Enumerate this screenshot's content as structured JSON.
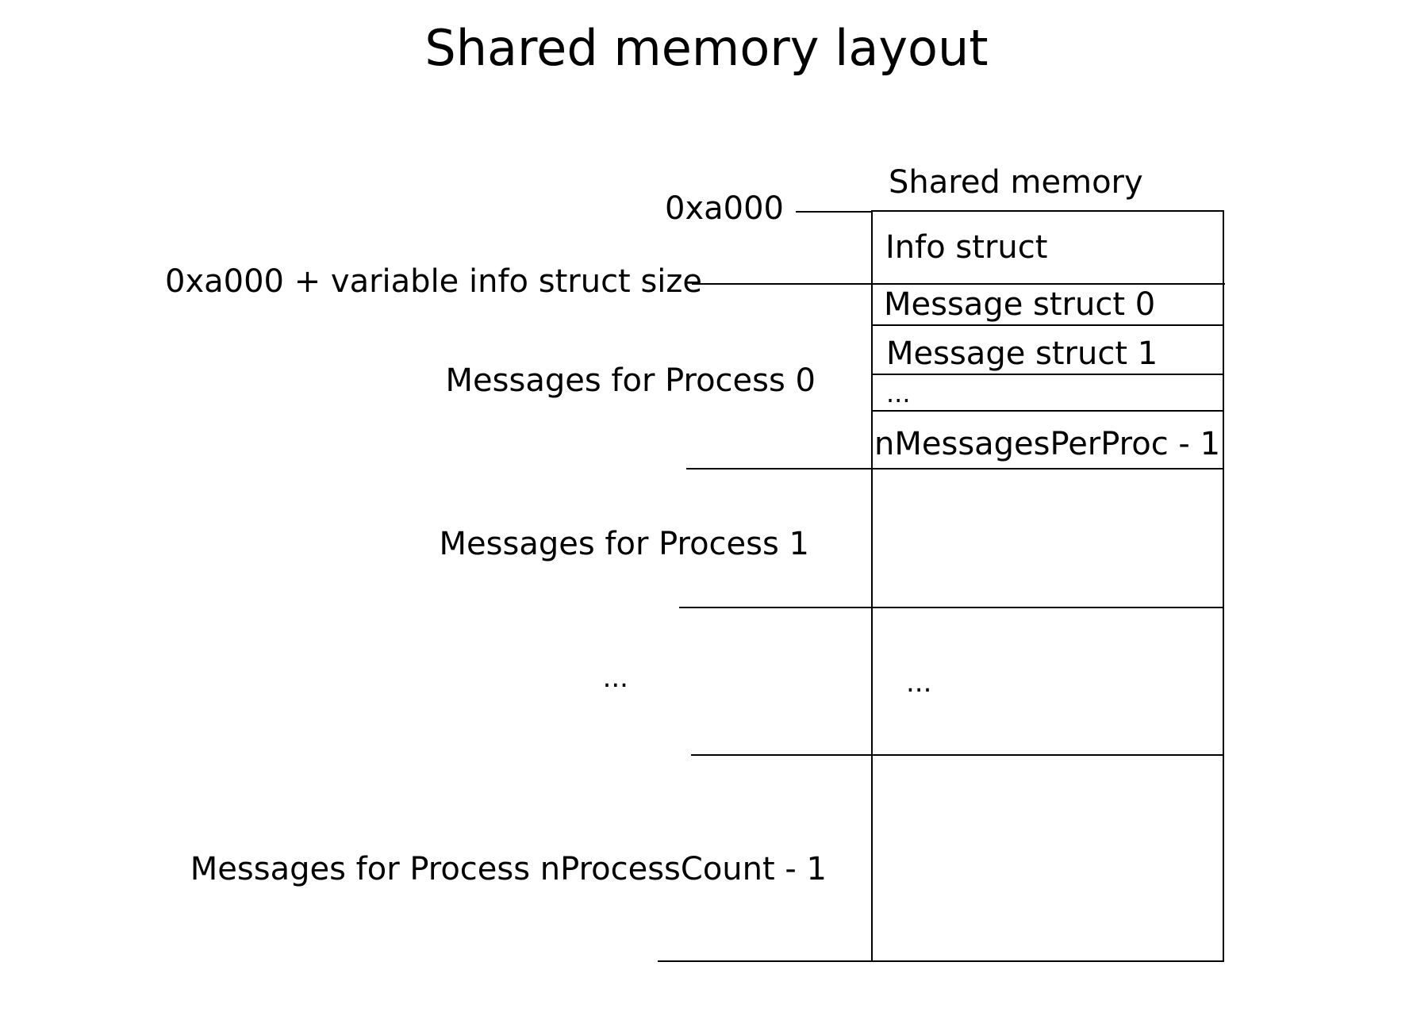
{
  "title": "Shared memory layout",
  "column_header": "Shared memory",
  "addresses": {
    "base": "0xa000",
    "after_info": "0xa000 + variable info struct size"
  },
  "cells": {
    "info_struct": "Info struct",
    "message_struct_0": "Message struct 0",
    "message_struct_1": "Message struct 1",
    "ellipsis_inner": "...",
    "message_last": "nMessagesPerProc - 1",
    "ellipsis_block": "..."
  },
  "labels": {
    "process_0": "Messages for Process 0",
    "process_1": "Messages for Process 1",
    "ellipsis": "...",
    "process_last": "Messages for Process nProcessCount - 1"
  }
}
